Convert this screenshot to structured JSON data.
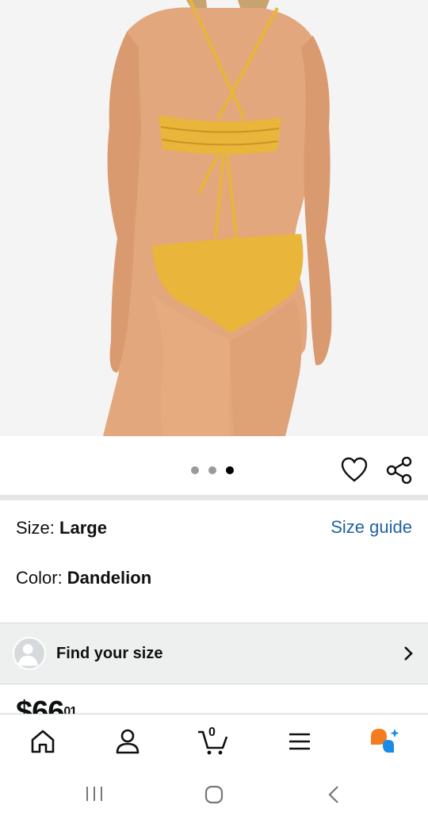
{
  "product": {
    "carousel": {
      "dot_count": 3,
      "active_index": 2
    },
    "size_label": "Size:",
    "size_value": "Large",
    "size_guide_label": "Size guide",
    "color_label": "Color:",
    "color_value": "Dandelion",
    "find_size_label": "Find your size",
    "price_partial": "$66",
    "price_cents_partial": "01"
  },
  "icons": {
    "wishlist": "heart-icon",
    "share": "share-icon",
    "find_size_chevron": "chevron-right-icon"
  },
  "bottom_nav": {
    "items": [
      "home-icon",
      "account-icon",
      "cart-icon",
      "menu-icon",
      "rufus-assistant-icon"
    ],
    "cart_count": "0"
  },
  "system_nav": [
    "recent-apps-icon",
    "home-circle-icon",
    "back-icon"
  ],
  "colors": {
    "link": "#2162a1",
    "swimsuit": "#e9b53a",
    "rufus_orange": "#f57c1e",
    "rufus_blue": "#1a8ae8"
  }
}
